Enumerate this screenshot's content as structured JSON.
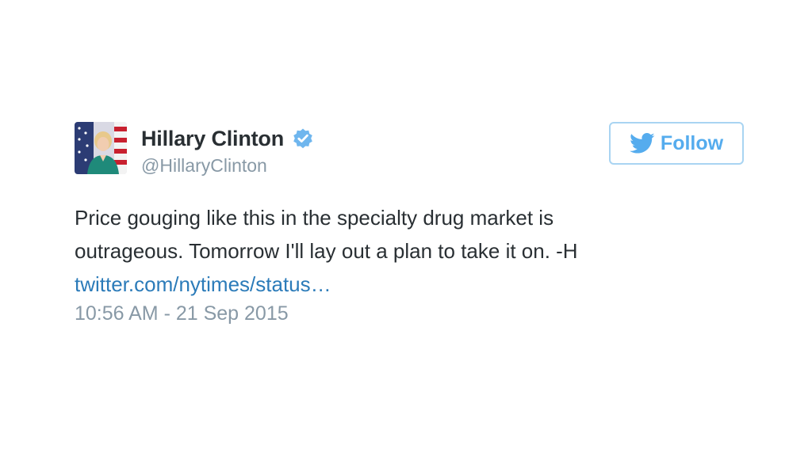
{
  "author": {
    "display_name": "Hillary Clinton",
    "handle": "@HillaryClinton",
    "verified": true
  },
  "follow_button": {
    "label": "Follow",
    "icon": "twitter-bird-icon"
  },
  "tweet": {
    "text_line_1": "Price gouging like this in the specialty drug market is",
    "text_line_2": "outrageous. Tomorrow I'll lay out a plan to take it on. -H",
    "link_text": "twitter.com/nytimes/status…",
    "timestamp": "10:56 AM - 21 Sep 2015"
  },
  "colors": {
    "link": "#2b7bb9",
    "twitter_blue": "#55acee",
    "muted_text": "#8899a6",
    "text": "#292f33"
  }
}
